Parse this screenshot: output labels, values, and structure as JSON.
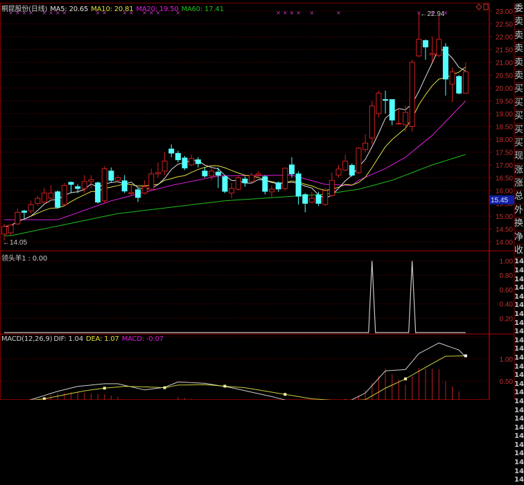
{
  "header": {
    "stock_name": "桐昆股份(日线)",
    "ma5": "MA5: 20.65",
    "ma10": "MA10: 20.81",
    "ma20": "MA20: 19.50",
    "ma60": "MA60: 17.41"
  },
  "indicator_header": "领头羊1 : 0.00",
  "macd_header": {
    "name": "MACD(12,26,9)",
    "dif": "DIF: 1.04",
    "dea": "DEA: 1.07",
    "macd": "MACD: -0.07"
  },
  "colors": {
    "up": "#d02020",
    "down": "#54ffff",
    "ma5": "#e0e0e0",
    "ma10": "#e0e040",
    "ma20": "#e020e0",
    "ma60": "#20c020",
    "grid": "#800000",
    "axis_text": "#c03030",
    "marker": "#c040c0"
  },
  "icons": {
    "top_right": [
      "diamond-icon",
      "square-icon"
    ]
  },
  "price_axis": {
    "labels": [
      "23.00",
      "22.50",
      "22.00",
      "21.50",
      "21.00",
      "20.50",
      "20.00",
      "19.50",
      "19.00",
      "18.50",
      "18.00",
      "17.50",
      "17.00",
      "16.50",
      "16.00",
      "15.50",
      "15.00",
      "14.50",
      "14.00"
    ],
    "current_price": "15.45",
    "high_note": "22.94",
    "low_note": "14.05"
  },
  "indicator_axis": {
    "labels": [
      "1.00",
      "0.80",
      "0.60",
      "0.40",
      "0.20"
    ]
  },
  "macd_axis": {
    "labels": [
      "1.00",
      "0.50"
    ]
  },
  "right_panel": {
    "labels": [
      "委",
      "卖",
      "卖",
      "卖",
      "卖",
      "卖",
      "买",
      "买",
      "买",
      "买",
      "买",
      "现",
      "涨",
      "涨",
      "总",
      "外",
      "换",
      "净",
      "收",
      "14:",
      "14:",
      "14:",
      "14:",
      "14:",
      "14:",
      "14:",
      "14:",
      "14:",
      "14:",
      "14:",
      "14:",
      "14:",
      "14:",
      "14:",
      "14:",
      "14:",
      "14:",
      "14:",
      "14:",
      "14:",
      "14:",
      "14:",
      "14:",
      "14:",
      "14:"
    ]
  },
  "chart_data": {
    "type": "candlestick",
    "price_range": [
      14.0,
      23.0
    ],
    "candles": [
      [
        14.3,
        14.7,
        14.05,
        14.6
      ],
      [
        14.35,
        14.7,
        14.25,
        14.65
      ],
      [
        14.7,
        15.3,
        14.65,
        15.15
      ],
      [
        15.2,
        15.25,
        14.9,
        15.15
      ],
      [
        15.2,
        15.6,
        15.1,
        15.45
      ],
      [
        15.5,
        15.8,
        15.4,
        15.7
      ],
      [
        15.55,
        16.1,
        15.5,
        15.9
      ],
      [
        15.7,
        16.2,
        15.6,
        15.9
      ],
      [
        15.95,
        16.0,
        15.3,
        15.35
      ],
      [
        15.45,
        16.3,
        15.4,
        16.2
      ],
      [
        16.32,
        16.35,
        15.9,
        16.24
      ],
      [
        16.15,
        16.25,
        15.9,
        16.08
      ],
      [
        16.08,
        16.6,
        15.9,
        16.35
      ],
      [
        16.35,
        16.6,
        16.1,
        16.42
      ],
      [
        16.3,
        16.35,
        15.5,
        15.55
      ],
      [
        15.6,
        16.95,
        15.5,
        16.85
      ],
      [
        16.76,
        16.9,
        16.3,
        16.4
      ],
      [
        16.4,
        16.6,
        16.3,
        16.5
      ],
      [
        16.38,
        16.6,
        15.9,
        15.98
      ],
      [
        15.88,
        16.2,
        15.8,
        15.92
      ],
      [
        16.03,
        16.1,
        15.55,
        15.73
      ],
      [
        15.9,
        16.4,
        15.85,
        16.15
      ],
      [
        16.05,
        16.85,
        16.0,
        16.65
      ],
      [
        16.65,
        17.1,
        16.5,
        16.7
      ],
      [
        16.76,
        17.5,
        16.6,
        17.15
      ],
      [
        17.62,
        17.8,
        17.3,
        17.46
      ],
      [
        17.45,
        17.55,
        17.1,
        17.2
      ],
      [
        17.27,
        17.35,
        16.8,
        16.88
      ],
      [
        17.0,
        17.4,
        16.95,
        17.25
      ],
      [
        17.2,
        17.3,
        16.9,
        17.05
      ],
      [
        16.76,
        16.9,
        16.5,
        16.57
      ],
      [
        16.57,
        16.85,
        16.4,
        16.76
      ],
      [
        16.72,
        16.9,
        16.1,
        16.6
      ],
      [
        16.54,
        16.6,
        15.9,
        15.97
      ],
      [
        15.9,
        16.3,
        15.7,
        16.08
      ],
      [
        16.05,
        16.6,
        16.0,
        16.5
      ],
      [
        16.45,
        16.55,
        16.15,
        16.3
      ],
      [
        16.35,
        16.7,
        16.3,
        16.6
      ],
      [
        16.6,
        16.75,
        16.5,
        16.65
      ],
      [
        16.54,
        16.6,
        15.85,
        15.97
      ],
      [
        15.95,
        16.2,
        15.75,
        16.05
      ],
      [
        16.3,
        16.35,
        15.95,
        16.06
      ],
      [
        16.08,
        16.9,
        16.0,
        16.87
      ],
      [
        17.0,
        17.3,
        16.5,
        16.65
      ],
      [
        16.65,
        16.75,
        15.45,
        15.78
      ],
      [
        15.84,
        15.9,
        15.15,
        15.5
      ],
      [
        15.55,
        15.95,
        15.5,
        15.7
      ],
      [
        15.82,
        15.95,
        15.4,
        15.5
      ],
      [
        15.46,
        16.1,
        15.4,
        16.0
      ],
      [
        15.8,
        16.7,
        15.75,
        16.4
      ],
      [
        16.6,
        17.0,
        16.5,
        16.84
      ],
      [
        16.8,
        17.4,
        16.75,
        17.15
      ],
      [
        16.98,
        17.05,
        16.55,
        16.6
      ],
      [
        16.7,
        17.7,
        16.65,
        17.65
      ],
      [
        17.6,
        18.2,
        17.5,
        17.85
      ],
      [
        18.05,
        19.5,
        17.8,
        19.3
      ],
      [
        19.0,
        19.9,
        18.85,
        19.8
      ],
      [
        19.55,
        19.9,
        19.0,
        19.52
      ],
      [
        19.55,
        19.55,
        18.55,
        18.75
      ],
      [
        18.6,
        19.2,
        18.6,
        18.62
      ],
      [
        18.57,
        19.3,
        18.3,
        19.05
      ],
      [
        18.5,
        21.1,
        18.3,
        21.0
      ],
      [
        21.25,
        22.94,
        21.2,
        21.9
      ],
      [
        21.85,
        21.9,
        21.1,
        21.6
      ],
      [
        21.3,
        22.0,
        21.0,
        21.35
      ],
      [
        21.27,
        22.8,
        21.2,
        21.9
      ],
      [
        21.6,
        21.75,
        19.7,
        20.35
      ],
      [
        20.15,
        20.8,
        19.45,
        20.63
      ],
      [
        20.45,
        20.5,
        19.75,
        19.8
      ],
      [
        19.8,
        21.0,
        19.8,
        20.63
      ]
    ],
    "ma20_points": [
      [
        0,
        14.86
      ],
      [
        8,
        14.86
      ],
      [
        16,
        15.6
      ],
      [
        25,
        16.2
      ],
      [
        32,
        16.57
      ],
      [
        43,
        16.6
      ],
      [
        48,
        16.24
      ],
      [
        52,
        16.2
      ],
      [
        53,
        16.4
      ],
      [
        57,
        16.86
      ],
      [
        60,
        17.3
      ],
      [
        64,
        18.15
      ],
      [
        69,
        19.5
      ]
    ],
    "ma60_points": [
      [
        1,
        14.24
      ],
      [
        17,
        15.1
      ],
      [
        33,
        15.6
      ],
      [
        48,
        15.86
      ],
      [
        53,
        16.05
      ],
      [
        58,
        16.4
      ],
      [
        64,
        17.0
      ],
      [
        69,
        17.41
      ]
    ],
    "indicator_values_nonzero": [
      [
        55,
        1.0
      ],
      [
        61,
        1.0
      ]
    ],
    "indicator_range": [
      0,
      1.0
    ],
    "dif_points": [
      [
        0,
        -0.05
      ],
      [
        4,
        0.08
      ],
      [
        8,
        0.27
      ],
      [
        11,
        0.38
      ],
      [
        15,
        0.44
      ],
      [
        17,
        0.44
      ],
      [
        21,
        0.3
      ],
      [
        24,
        0.36
      ],
      [
        26,
        0.48
      ],
      [
        30,
        0.45
      ],
      [
        34,
        0.35
      ],
      [
        40,
        0.15
      ],
      [
        44,
        0.0
      ],
      [
        48,
        -0.1
      ],
      [
        50,
        -0.05
      ],
      [
        52,
        0.08
      ],
      [
        54,
        0.23
      ],
      [
        57,
        0.73
      ],
      [
        60,
        0.76
      ],
      [
        62,
        1.12
      ],
      [
        65,
        1.36
      ],
      [
        68,
        1.2
      ],
      [
        69,
        1.04
      ]
    ],
    "dea_points": [
      [
        0,
        0.0
      ],
      [
        6,
        0.1
      ],
      [
        9,
        0.19
      ],
      [
        12,
        0.28
      ],
      [
        15,
        0.34
      ],
      [
        18,
        0.38
      ],
      [
        21,
        0.37
      ],
      [
        24,
        0.35
      ],
      [
        26,
        0.41
      ],
      [
        30,
        0.42
      ],
      [
        36,
        0.35
      ],
      [
        40,
        0.25
      ],
      [
        46,
        0.1
      ],
      [
        51,
        0.05
      ],
      [
        54,
        0.08
      ],
      [
        57,
        0.34
      ],
      [
        60,
        0.55
      ],
      [
        63,
        0.81
      ],
      [
        66,
        1.06
      ],
      [
        69,
        1.07
      ]
    ],
    "top_markers": [
      1,
      2,
      3,
      4,
      6,
      7,
      8,
      9,
      14,
      15,
      18,
      19,
      21,
      22,
      23,
      26,
      41,
      42,
      43,
      44,
      46,
      50,
      62,
      64,
      66
    ]
  }
}
